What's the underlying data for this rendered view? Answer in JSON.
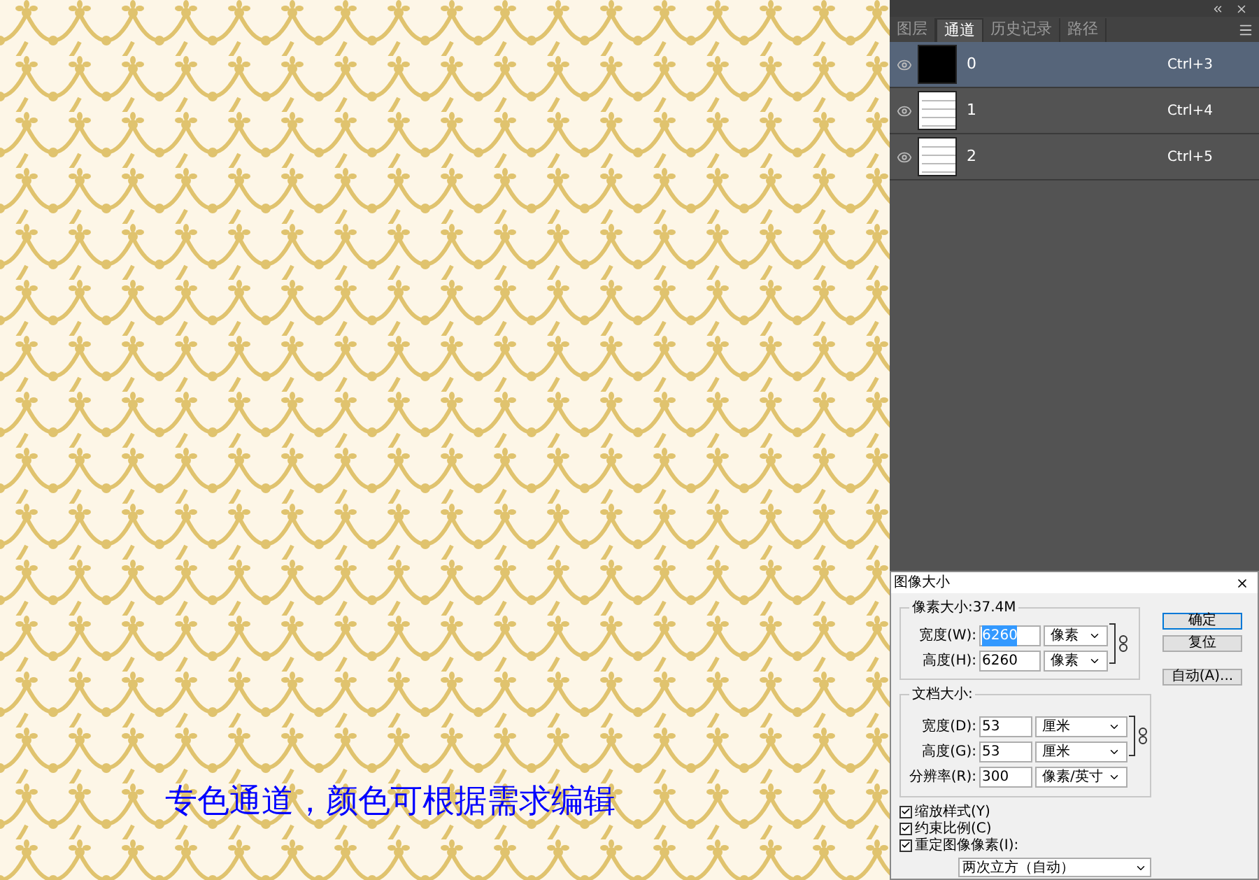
{
  "caption": "专色通道，颜色可根据需求编辑",
  "panel": {
    "tabs": [
      {
        "label": "图层",
        "selected": false
      },
      {
        "label": "通道",
        "selected": true
      },
      {
        "label": "历史记录",
        "selected": false
      },
      {
        "label": "路径",
        "selected": false
      }
    ],
    "channels": [
      {
        "name": "0",
        "shortcut": "Ctrl+3",
        "kind": "solid",
        "visible": true,
        "selected": true
      },
      {
        "name": "1",
        "shortcut": "Ctrl+4",
        "kind": "lines",
        "visible": true,
        "selected": false
      },
      {
        "name": "2",
        "shortcut": "Ctrl+5",
        "kind": "lines",
        "visible": true,
        "selected": false
      }
    ]
  },
  "dialog": {
    "title": "图像大小",
    "pixel_group": {
      "legend": "像素大小:37.4M",
      "rows": [
        {
          "label": "宽度(W):",
          "value": "6260",
          "unit": "像素",
          "highlighted": true
        },
        {
          "label": "高度(H):",
          "value": "6260",
          "unit": "像素",
          "highlighted": false
        }
      ]
    },
    "document_group": {
      "legend": "文档大小:",
      "linked": true,
      "rows": [
        {
          "label": "宽度(D):",
          "value": "53",
          "unit": "厘米"
        },
        {
          "label": "高度(G):",
          "value": "53",
          "unit": "厘米"
        },
        {
          "label": "分辨率(R):",
          "value": "300",
          "unit": "像素/英寸"
        }
      ]
    },
    "checkboxes": [
      {
        "label": "缩放样式(Y)",
        "checked": true
      },
      {
        "label": "约束比例(C)",
        "checked": true
      },
      {
        "label": "重定图像像素(I):",
        "checked": true
      }
    ],
    "resample": "两次立方（自动）",
    "buttons": [
      {
        "label": "确定",
        "default": true
      },
      {
        "label": "复位",
        "default": false
      },
      {
        "label": "自动(A)...",
        "default": false
      }
    ]
  }
}
